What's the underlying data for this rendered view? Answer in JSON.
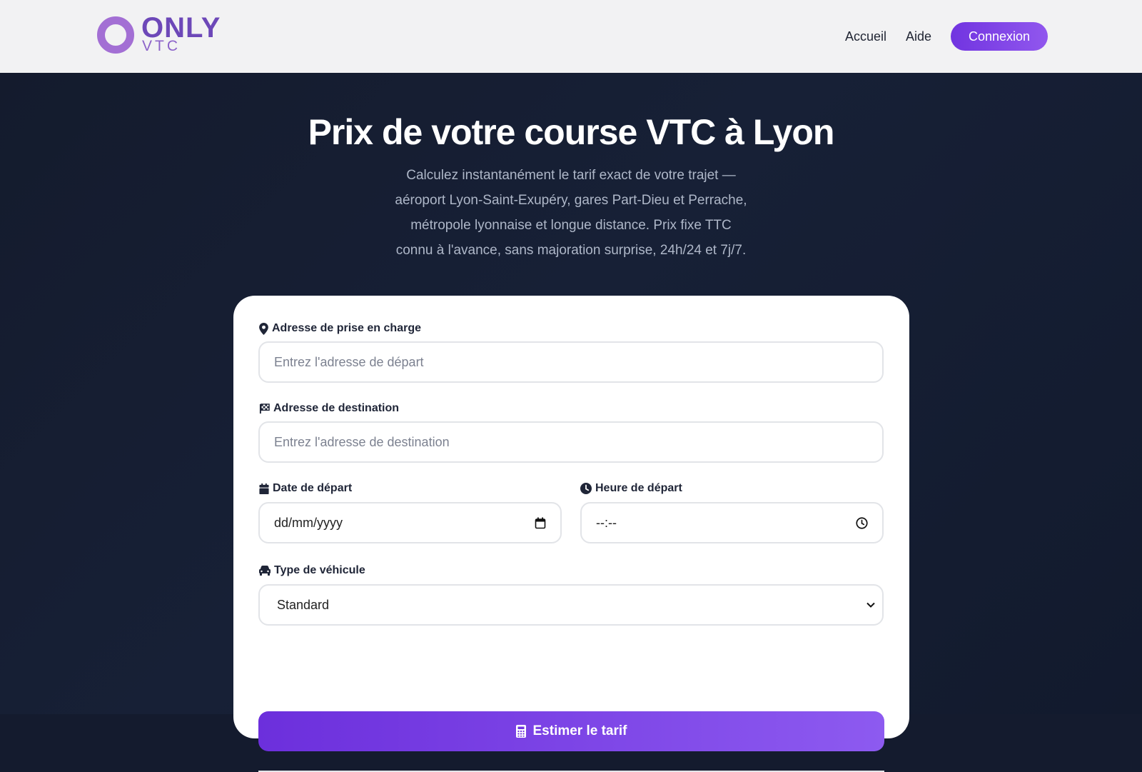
{
  "header": {
    "logo_main": "ONLY",
    "logo_sub": "VTC",
    "nav": [
      "Accueil",
      "Aide"
    ],
    "login_label": "Connexion"
  },
  "hero": {
    "title": "Prix de votre course VTC à Lyon",
    "subtitle_lines": [
      "Calculez instantanément le tarif exact de votre trajet —",
      "aéroport Lyon-Saint-Exupéry, gares Part-Dieu et Perrache,",
      "métropole lyonnaise et longue distance. Prix fixe TTC",
      "connu à l'avance, sans majoration surprise, 24h/24 et 7j/7."
    ]
  },
  "form": {
    "pickup_label": "Adresse de prise en charge",
    "pickup_placeholder": "Entrez l'adresse de départ",
    "destination_label": "Adresse de destination",
    "destination_placeholder": "Entrez l'adresse de destination",
    "date_label": "Date de départ",
    "date_value": "dd/mm/yyyy",
    "time_label": "Heure de départ",
    "time_value": "--:--",
    "vehicle_label": "Type de véhicule",
    "vehicle_selected": "Standard",
    "submit_label": "Estimer le tarif"
  },
  "icons": {
    "pickup": "map-pin-icon",
    "destination": "checkered-flag-icon",
    "date": "calendar-icon",
    "time": "clock-icon",
    "vehicle": "car-icon",
    "submit": "calculator-icon",
    "select": "chevron-down-icon"
  },
  "colors": {
    "accent": "#7134e0",
    "accent_light": "#9157ee",
    "hero_bg": "#141b2e",
    "logo": "#6d48b8"
  }
}
